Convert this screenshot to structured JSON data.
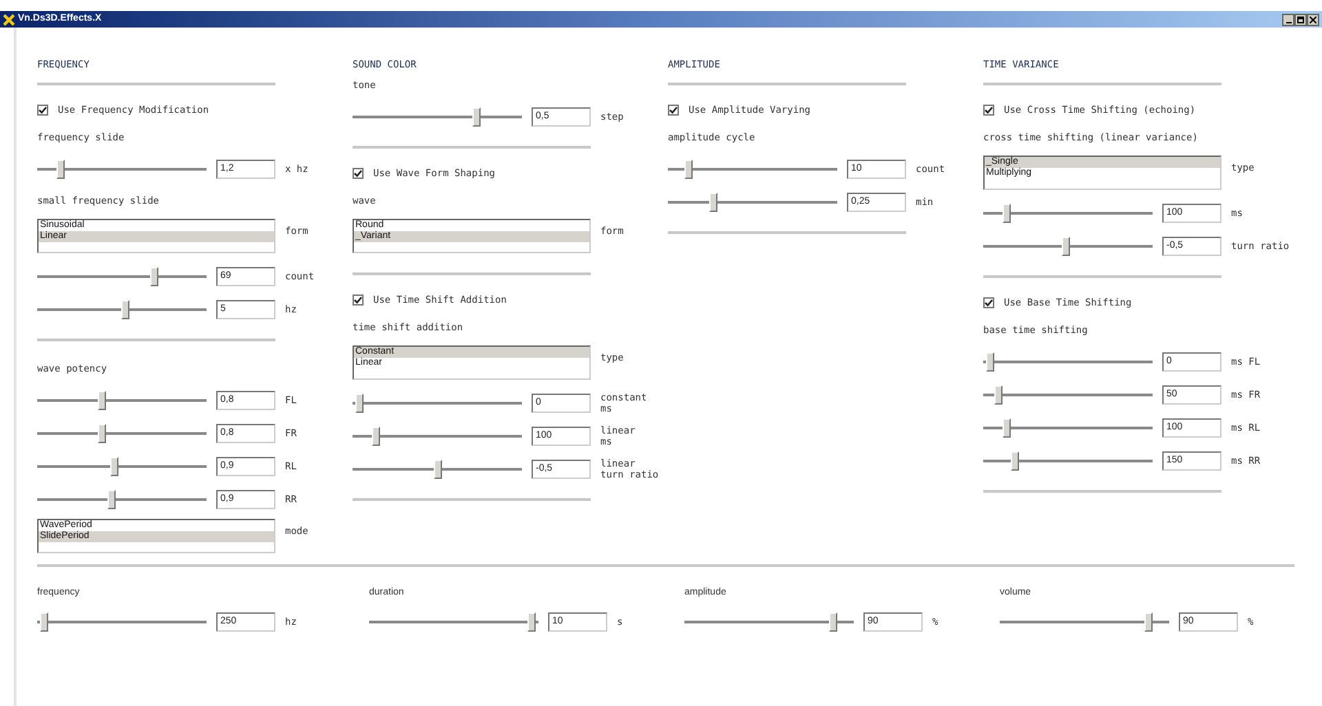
{
  "window": {
    "title": "Vn.Ds3D.Effects.X"
  },
  "columns": [
    {
      "items": [
        {
          "kind": "heading",
          "text": "FREQUENCY"
        },
        {
          "kind": "separator"
        },
        {
          "kind": "checkbox",
          "label": "Use Frequency Modification",
          "checked": true
        },
        {
          "kind": "label",
          "text": "frequency slide"
        },
        {
          "kind": "slider",
          "level": 0.12,
          "value": "1,2",
          "unit": "x hz"
        },
        {
          "kind": "label",
          "text": "small frequency slide"
        },
        {
          "kind": "listbox",
          "options": [
            {
              "label": "Sinusoidal",
              "selected": false
            },
            {
              "label": "Linear",
              "selected": true
            }
          ],
          "unit": "form"
        },
        {
          "kind": "slider",
          "level": 0.7,
          "value": "69",
          "unit": "count"
        },
        {
          "kind": "slider",
          "level": 0.52,
          "value": "5",
          "unit": "hz"
        },
        {
          "kind": "separator"
        },
        {
          "kind": "label",
          "text": "wave potency"
        },
        {
          "kind": "slider",
          "level": 0.38,
          "value": "0,8",
          "unit": "FL"
        },
        {
          "kind": "slider",
          "level": 0.38,
          "value": "0,8",
          "unit": "FR"
        },
        {
          "kind": "slider",
          "level": 0.45,
          "value": "0,9",
          "unit": "RL"
        },
        {
          "kind": "slider",
          "level": 0.44,
          "value": "0,9",
          "unit": "RR"
        },
        {
          "kind": "listbox",
          "options": [
            {
              "label": "WavePeriod",
              "selected": false
            },
            {
              "label": "SlidePeriod",
              "selected": true
            }
          ],
          "unit": "mode"
        }
      ]
    },
    {
      "items": [
        {
          "kind": "heading",
          "text": "SOUND COLOR"
        },
        {
          "kind": "label",
          "text": "tone"
        },
        {
          "kind": "slider",
          "level": 0.74,
          "value": "0,5",
          "unit": "step"
        },
        {
          "kind": "separator"
        },
        {
          "kind": "checkbox",
          "label": "Use Wave Form Shaping",
          "checked": true
        },
        {
          "kind": "label",
          "text": "wave"
        },
        {
          "kind": "listbox",
          "options": [
            {
              "label": "Round",
              "selected": false
            },
            {
              "label": "_Variant",
              "selected": true
            }
          ],
          "unit": "form"
        },
        {
          "kind": "separator"
        },
        {
          "kind": "checkbox",
          "label": "Use Time Shift Addition",
          "checked": true
        },
        {
          "kind": "label",
          "text": "time shift addition"
        },
        {
          "kind": "listbox",
          "options": [
            {
              "label": "Constant",
              "selected": true
            },
            {
              "label": "Linear",
              "selected": false
            }
          ],
          "unit": "type"
        },
        {
          "kind": "slider",
          "level": 0.02,
          "value": "0",
          "unit": "constant\nms"
        },
        {
          "kind": "slider",
          "level": 0.12,
          "value": "100",
          "unit": "linear\nms"
        },
        {
          "kind": "slider",
          "level": 0.5,
          "value": "-0,5",
          "unit": "linear\nturn ratio"
        },
        {
          "kind": "separator"
        }
      ]
    },
    {
      "items": [
        {
          "kind": "heading",
          "text": "AMPLITUDE"
        },
        {
          "kind": "separator"
        },
        {
          "kind": "checkbox",
          "label": "Use Amplitude Varying",
          "checked": true
        },
        {
          "kind": "label",
          "text": "amplitude cycle"
        },
        {
          "kind": "slider",
          "level": 0.1,
          "value": "10",
          "unit": "count"
        },
        {
          "kind": "slider",
          "level": 0.26,
          "value": "0,25",
          "unit": "min"
        },
        {
          "kind": "separator"
        }
      ]
    },
    {
      "items": [
        {
          "kind": "heading",
          "text": "TIME VARIANCE"
        },
        {
          "kind": "separator"
        },
        {
          "kind": "checkbox",
          "label": "Use Cross Time Shifting (echoing)",
          "checked": true
        },
        {
          "kind": "label",
          "text": "cross time shifting (linear variance)"
        },
        {
          "kind": "listbox",
          "options": [
            {
              "label": "_Single",
              "selected": true
            },
            {
              "label": "Multiplying",
              "selected": false
            }
          ],
          "unit": "type"
        },
        {
          "kind": "slider",
          "level": 0.12,
          "value": "100",
          "unit": "ms"
        },
        {
          "kind": "slider",
          "level": 0.49,
          "value": "-0,5",
          "unit": "turn ratio"
        },
        {
          "kind": "separator"
        },
        {
          "kind": "checkbox",
          "label": "Use Base Time Shifting",
          "checked": true
        },
        {
          "kind": "label",
          "text": "base time shifting"
        },
        {
          "kind": "slider",
          "level": 0.02,
          "value": "0",
          "unit": "ms FL"
        },
        {
          "kind": "slider",
          "level": 0.07,
          "value": "50",
          "unit": "ms FR"
        },
        {
          "kind": "slider",
          "level": 0.12,
          "value": "100",
          "unit": "ms RL"
        },
        {
          "kind": "slider",
          "level": 0.17,
          "value": "150",
          "unit": "ms RR"
        },
        {
          "kind": "separator"
        }
      ]
    }
  ],
  "bottom": [
    {
      "label": "frequency",
      "level": 0.02,
      "value": "250",
      "unit": "hz"
    },
    {
      "label": "duration",
      "level": 0.98,
      "value": "10",
      "unit": "s"
    },
    {
      "label": "amplitude",
      "level": 0.9,
      "value": "90",
      "unit": "%"
    },
    {
      "label": "volume",
      "level": 0.9,
      "value": "90",
      "unit": "%"
    }
  ]
}
